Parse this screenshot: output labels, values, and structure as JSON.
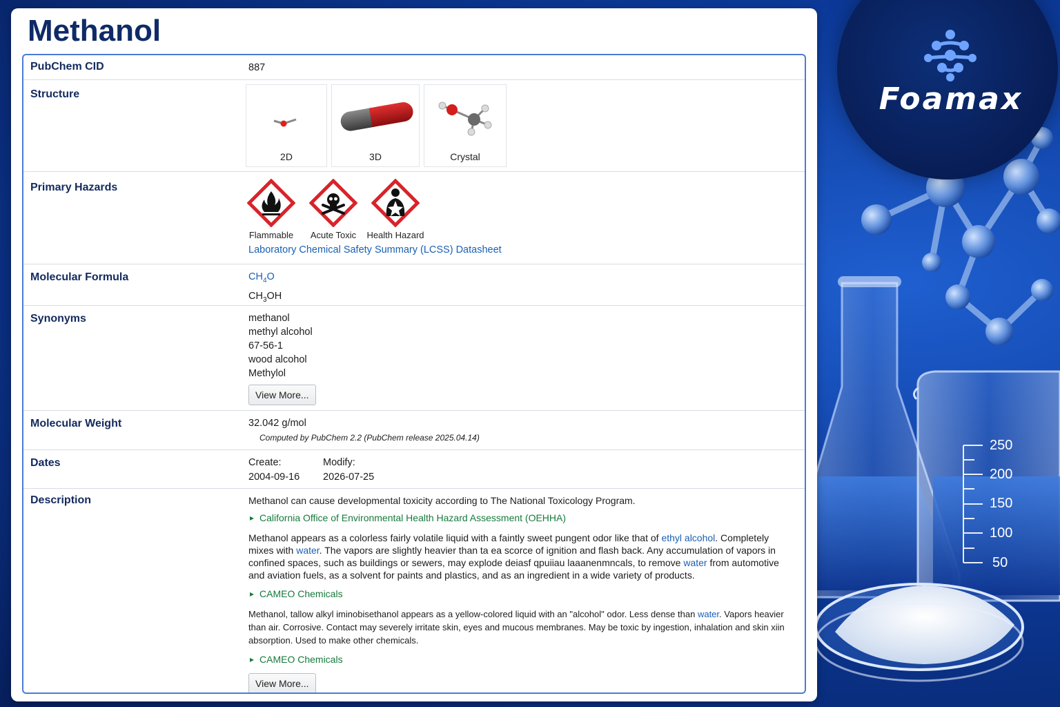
{
  "title": "Methanol",
  "brand": {
    "name": "Foamax"
  },
  "beaker_ticks": [
    "250",
    "200",
    "150",
    "100",
    "50"
  ],
  "rows": {
    "cid": {
      "label": "PubChem CID",
      "value": "887"
    },
    "structure": {
      "label": "Structure",
      "images": [
        "2D",
        "3D",
        "Crystal"
      ]
    },
    "hazards": {
      "label": "Primary Hazards",
      "items": [
        {
          "name": "Flammable",
          "icon": "flame-icon"
        },
        {
          "name": "Acute Toxic",
          "icon": "skull-icon"
        },
        {
          "name": "Health Hazard",
          "icon": "health-hazard-icon"
        }
      ],
      "lcss_link": "Laboratory Chemical Safety Summary (LCSS) Datasheet"
    },
    "formula": {
      "label": "Molecular Formula",
      "f1_a": "CH",
      "f1_sub": "4",
      "f1_b": "O",
      "f2_a": "CH",
      "f2_sub": "3",
      "f2_b": "OH"
    },
    "synonyms": {
      "label": "Synonyms",
      "items": [
        "methanol",
        "methyl alcohol",
        "67-56-1",
        "wood alcohol",
        "Methylol"
      ],
      "view_more": "View More..."
    },
    "weight": {
      "label": "Molecular Weight",
      "value": "32.042 g/mol",
      "note": "Computed by PubChem 2.2 (PubChem release 2025.04.14)"
    },
    "dates": {
      "label": "Dates",
      "create_label": "Create:",
      "create_value": "2004-09-16",
      "modify_label": "Modify:",
      "modify_value": "2026-07-25"
    },
    "description": {
      "label": "Description",
      "p1": "Methanol can cause developmental toxicity according to The National Toxicology Program.",
      "src1": "California Office of Environmental Health Hazard Assessment (OEHHA)",
      "p2_a": "Methanol appears as a colorless fairly volatile liquid with a faintly sweet pungent odor like that of ",
      "p2_link1": "ethyl alcohol",
      "p2_b": ". Completely mixes with ",
      "p2_link2": "water",
      "p2_c": ". The vapors are slightly heavier than ta ea scorce of ignition and flash back. Any accumulation of vapors in confined spaces, such as buildings or sewers, may explode deiasf qpuiiau laaanenmncals, to remove ",
      "p2_link3": "water",
      "p2_d": " from automotive and aviation fuels, as a solvent for paints and plastics, and as an ingredient in a wide variety of products.",
      "src2": "CAMEO Chemicals",
      "p3_a": "Methanol, tallow alkyl iminobisethanol appears as a yellow-colored liquid with an \"alcohol\" odor. Less dense than ",
      "p3_link": "water",
      "p3_b": ". Vapors heavier than air. Corrosive. Contact may severely irritate skin, eyes and mucous membranes. May be toxic by ingestion, inhalation and skin xiin absorption. Used to make other chemicals.",
      "src3": "CAMEO Chemicals",
      "view_more": "View More..."
    }
  }
}
